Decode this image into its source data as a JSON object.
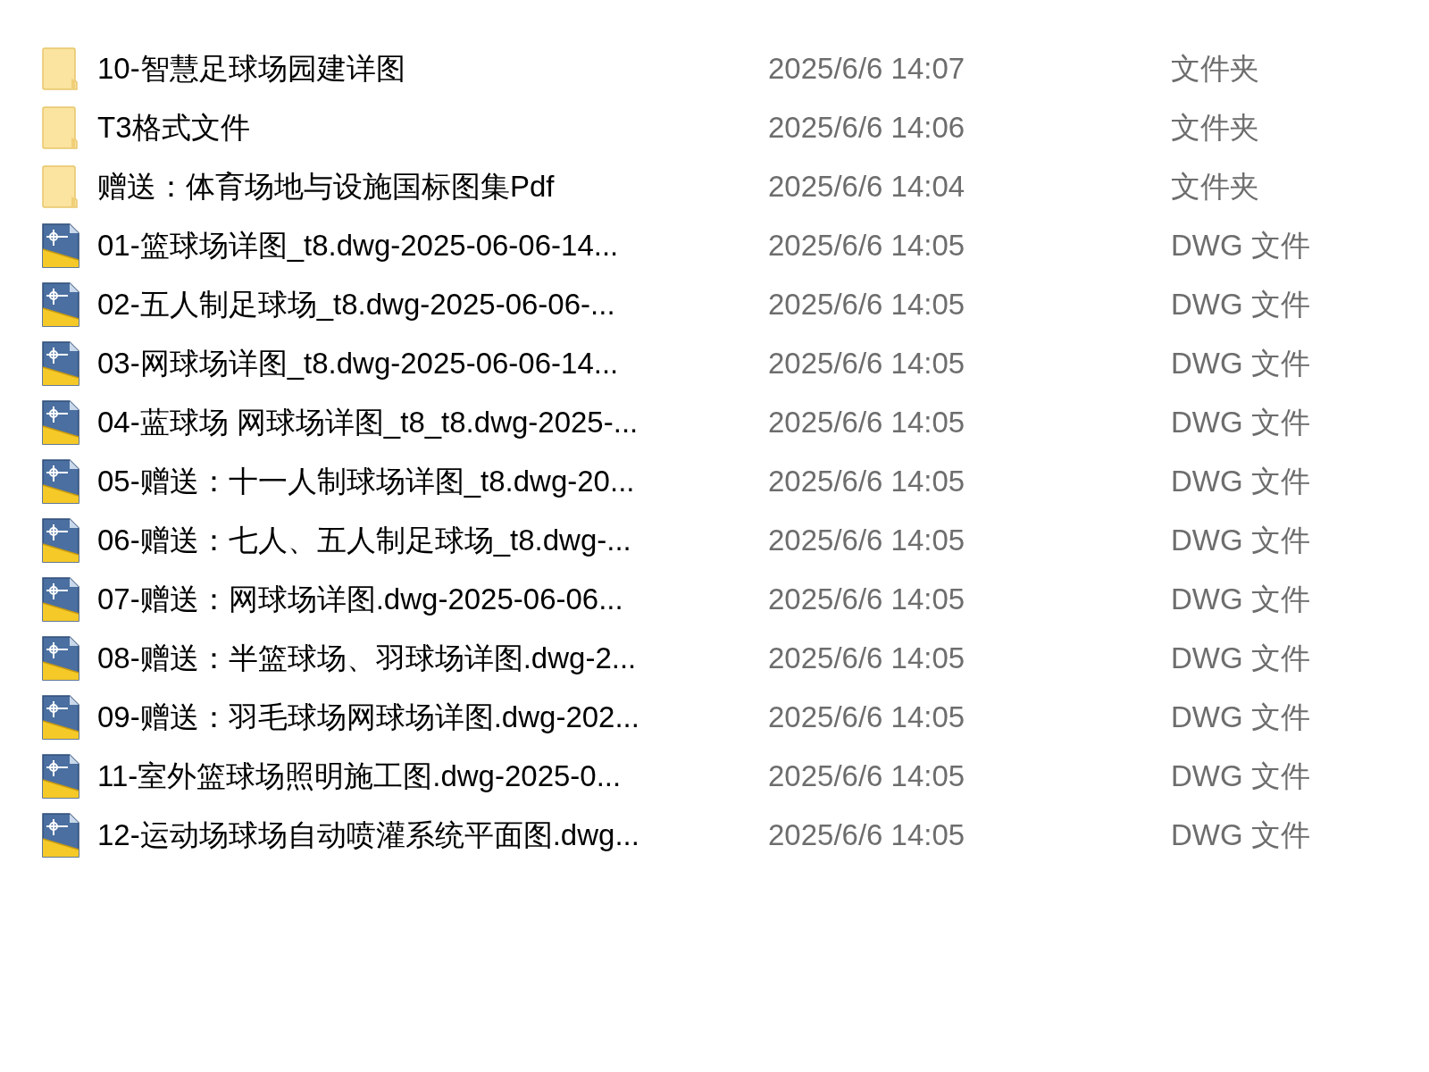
{
  "files": [
    {
      "kind": "folder",
      "name": "10-智慧足球场园建详图",
      "date": "2025/6/6 14:07",
      "type": "文件夹"
    },
    {
      "kind": "folder",
      "name": "T3格式文件",
      "date": "2025/6/6 14:06",
      "type": "文件夹"
    },
    {
      "kind": "folder",
      "name": "赠送：体育场地与设施国标图集Pdf",
      "date": "2025/6/6 14:04",
      "type": "文件夹"
    },
    {
      "kind": "dwg",
      "name": "01-篮球场详图_t8.dwg-2025-06-06-14...",
      "date": "2025/6/6 14:05",
      "type": "DWG 文件"
    },
    {
      "kind": "dwg",
      "name": "02-五人制足球场_t8.dwg-2025-06-06-...",
      "date": "2025/6/6 14:05",
      "type": "DWG 文件"
    },
    {
      "kind": "dwg",
      "name": "03-网球场详图_t8.dwg-2025-06-06-14...",
      "date": "2025/6/6 14:05",
      "type": "DWG 文件"
    },
    {
      "kind": "dwg",
      "name": "04-蓝球场 网球场详图_t8_t8.dwg-2025-...",
      "date": "2025/6/6 14:05",
      "type": "DWG 文件"
    },
    {
      "kind": "dwg",
      "name": "05-赠送：十一人制球场详图_t8.dwg-20...",
      "date": "2025/6/6 14:05",
      "type": "DWG 文件"
    },
    {
      "kind": "dwg",
      "name": "06-赠送：七人、五人制足球场_t8.dwg-...",
      "date": "2025/6/6 14:05",
      "type": "DWG 文件"
    },
    {
      "kind": "dwg",
      "name": "07-赠送：网球场详图.dwg-2025-06-06...",
      "date": "2025/6/6 14:05",
      "type": "DWG 文件"
    },
    {
      "kind": "dwg",
      "name": "08-赠送：半篮球场、羽球场详图.dwg-2...",
      "date": "2025/6/6 14:05",
      "type": "DWG 文件"
    },
    {
      "kind": "dwg",
      "name": "09-赠送：羽毛球场网球场详图.dwg-202...",
      "date": "2025/6/6 14:05",
      "type": "DWG 文件"
    },
    {
      "kind": "dwg",
      "name": "11-室外篮球场照明施工图.dwg-2025-0...",
      "date": "2025/6/6 14:05",
      "type": "DWG 文件"
    },
    {
      "kind": "dwg",
      "name": "12-运动场球场自动喷灌系统平面图.dwg...",
      "date": "2025/6/6 14:05",
      "type": "DWG 文件"
    }
  ]
}
